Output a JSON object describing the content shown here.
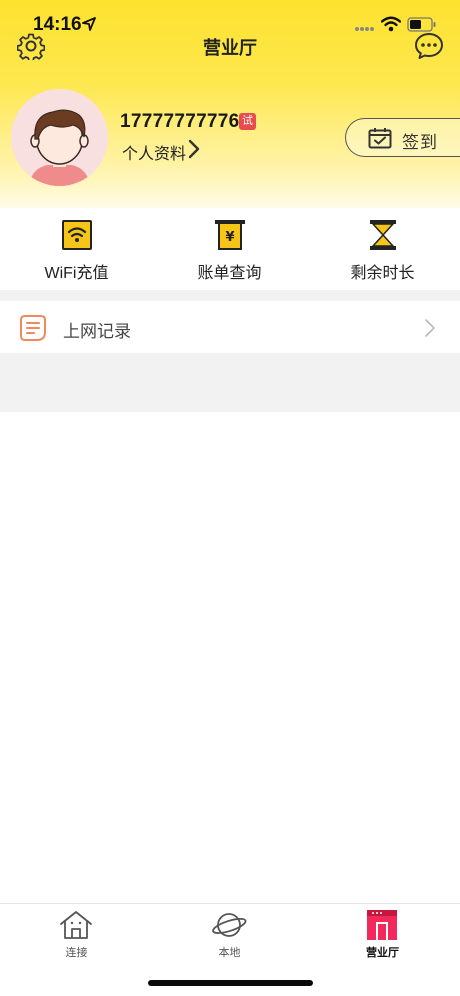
{
  "status_bar": {
    "time": "14:16",
    "icons": [
      "location-arrow-icon",
      "signal-dots-icon",
      "wifi-icon",
      "battery-icon"
    ]
  },
  "nav": {
    "title": "营业厅",
    "left_icon": "gear-icon",
    "right_icon": "message-icon"
  },
  "profile": {
    "phone": "17777777776",
    "badge": "试",
    "link_label": "个人资料"
  },
  "checkin": {
    "label": "签到",
    "icon": "calendar-check-icon"
  },
  "quick_menu": [
    {
      "label": "WiFi充值",
      "icon": "wifi-card-icon"
    },
    {
      "label": "账单查询",
      "icon": "bill-icon"
    },
    {
      "label": "剩余时长",
      "icon": "hourglass-icon"
    }
  ],
  "records": {
    "label": "上网记录",
    "icon": "document-list-icon"
  },
  "tabbar": [
    {
      "label": "连接",
      "icon": "house-icon",
      "active": false
    },
    {
      "label": "本地",
      "icon": "planet-icon",
      "active": false
    },
    {
      "label": "营业厅",
      "icon": "storefront-icon",
      "active": true
    }
  ],
  "colors": {
    "header_yellow": "#fde22e",
    "accent_red": "#e94c4c",
    "active_tab_pink": "#f2295b",
    "icon_gold": "#f5c518",
    "record_icon_orange": "#f08a5d"
  }
}
